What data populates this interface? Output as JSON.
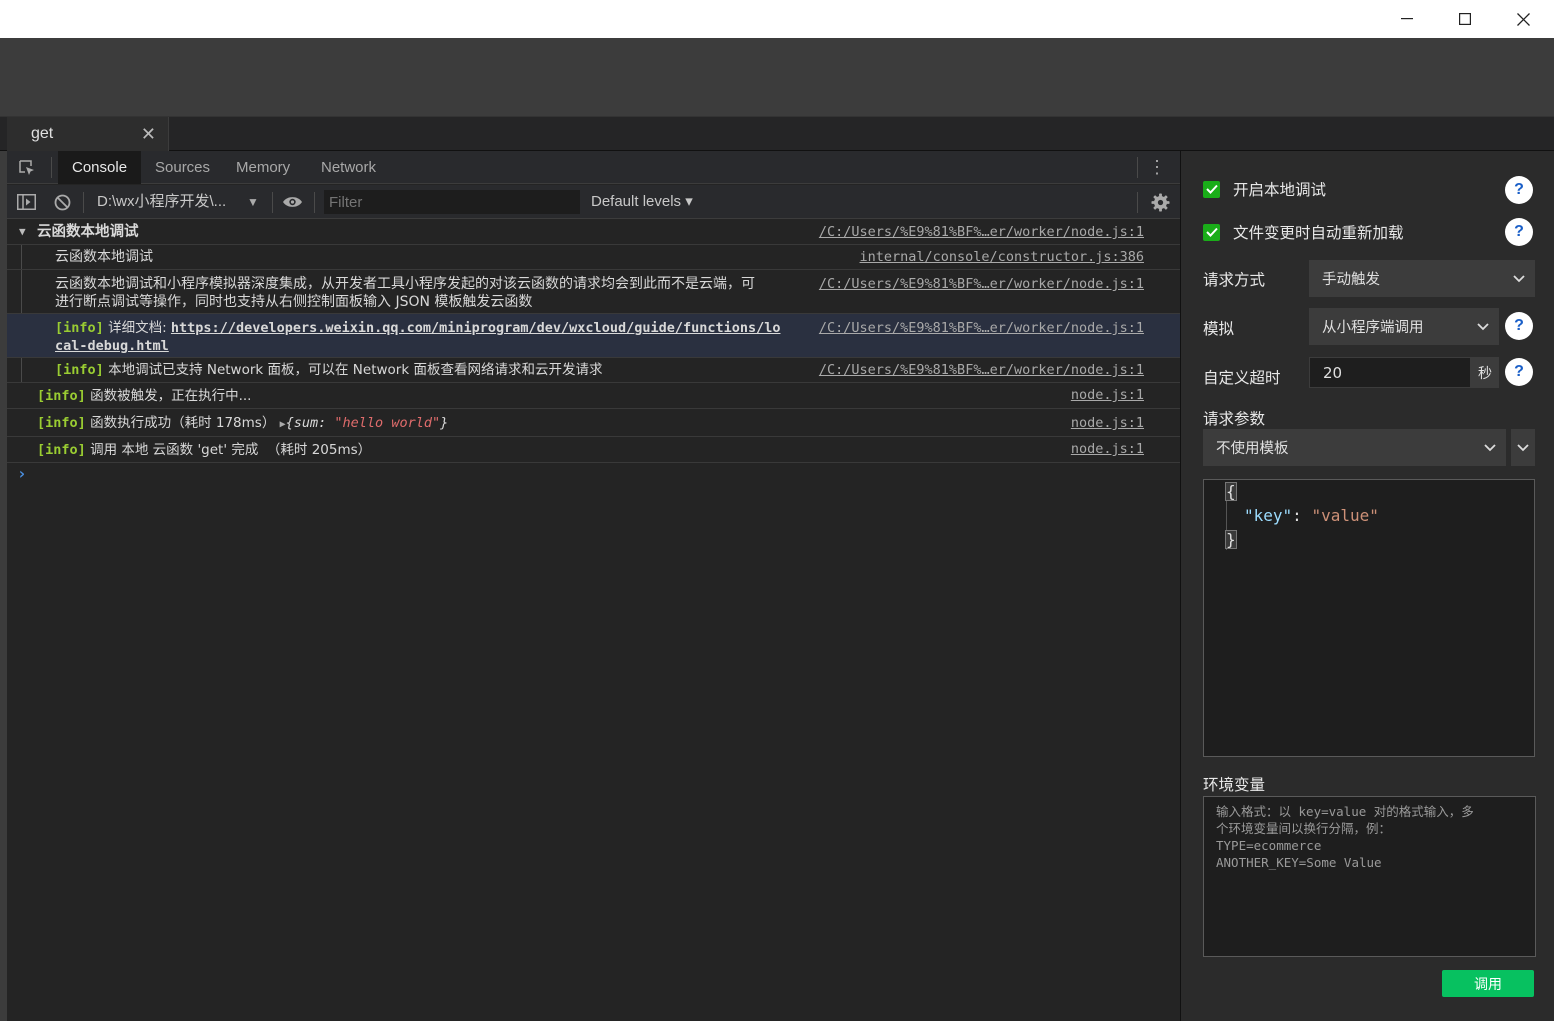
{
  "window": {
    "minimize_icon": "minimize-icon",
    "maximize_icon": "maximize-icon",
    "close_icon": "close-icon"
  },
  "file_tab": {
    "label": "get",
    "close": "✕"
  },
  "devtools": {
    "tabs": [
      "Console",
      "Sources",
      "Memory",
      "Network"
    ],
    "active_tab": "Console",
    "context": "D:\\wx小程序开发\\...",
    "filter_placeholder": "Filter",
    "levels": "Default levels ▾"
  },
  "console": {
    "group_title": "云函数本地调试",
    "group_src": "/C:/Users/%E9%81%BF%…er/worker/node.js:1",
    "rows": [
      {
        "text": "云函数本地调试",
        "src": "internal/console/constructor.js:386"
      },
      {
        "line1": "云函数本地调试和小程序模拟器深度集成，从开发者工具小程序发起的对该云函数的请求均会到此而不是云端，可",
        "line2": "进行断点调试等操作，同时也支持从右侧控制面板输入 JSON 模板触发云函数",
        "src": "/C:/Users/%E9%81%BF%…er/worker/node.js:1"
      },
      {
        "tag": "[info]",
        "label": " 详细文档: ",
        "link1": "https://developers.weixin.qq.com/miniprogram/dev/wxcloud/guide/functions/lo",
        "link2": "cal-debug.html",
        "src": "/C:/Users/%E9%81%BF%…er/worker/node.js:1"
      },
      {
        "tag": "[info]",
        "text": " 本地调试已支持 Network 面板，可以在 Network 面板查看网络请求和云开发请求",
        "src": "/C:/Users/%E9%81%BF%…er/worker/node.js:1"
      }
    ],
    "outer_rows": [
      {
        "tag": "[info]",
        "text": " 函数被触发，正在执行中...",
        "src": "node.js:1"
      },
      {
        "tag": "[info]",
        "text": " 函数执行成功（耗时 178ms） ",
        "obj_open": "{sum: ",
        "obj_val": "\"hello world\"",
        "obj_close": "}",
        "src": "node.js:1"
      },
      {
        "tag": "[info]",
        "text": " 调用 本地 云函数 'get' 完成  （耗时 205ms）",
        "src": "node.js:1"
      }
    ],
    "prompt": "›"
  },
  "panel": {
    "enable_local_debug": "开启本地调试",
    "auto_reload": "文件变更时自动重新加载",
    "request_method_label": "请求方式",
    "request_method_value": "手动触发",
    "simulate_label": "模拟",
    "simulate_value": "从小程序端调用",
    "timeout_label": "自定义超时",
    "timeout_value": "20",
    "timeout_unit": "秒",
    "params_label": "请求参数",
    "template_value": "不使用模板",
    "json": {
      "open": "{",
      "key": "\"key\"",
      "colon": ": ",
      "value": "\"value\"",
      "close": "}"
    },
    "env_label": "环境变量",
    "env_placeholder": "输入格式：以 key=value 对的格式输入，多\n个环境变量间以换行分隔，例：\nTYPE=ecommerce\nANOTHER_KEY=Some Value",
    "invoke_button": "调用",
    "help": "?"
  },
  "colors": {
    "accent_green": "#07c160",
    "checkbox_green": "#1aad19",
    "info_tag": "#9acd32",
    "string_red": "#e06c6c",
    "help_blue": "#1a5fc8"
  }
}
